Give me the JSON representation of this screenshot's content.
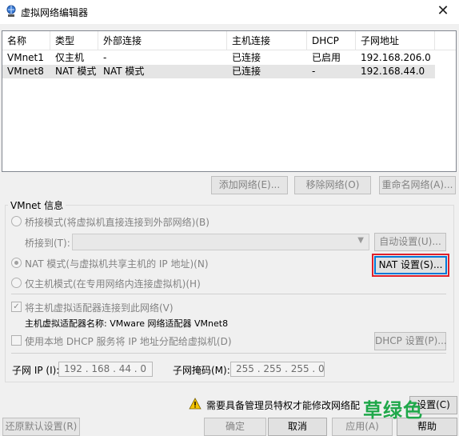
{
  "window": {
    "title": "虚拟网络编辑器",
    "close": "✕"
  },
  "table": {
    "columns": [
      "名称",
      "类型",
      "外部连接",
      "主机连接",
      "DHCP",
      "子网地址"
    ],
    "rows": [
      [
        "VMnet1",
        "仅主机",
        "-",
        "已连接",
        "已启用",
        "192.168.206.0"
      ],
      [
        "VMnet8",
        "NAT 模式",
        "NAT 模式",
        "已连接",
        "-",
        "192.168.44.0"
      ]
    ],
    "selected_row": 1
  },
  "list_buttons": {
    "add": "添加网络(E)...",
    "remove": "移除网络(O)",
    "rename": "重命名网络(A)..."
  },
  "vmnet_info": {
    "label": "VMnet 信息",
    "bridged": "桥接模式(将虚拟机直接连接到外部网络)(B)",
    "bridged_to": "桥接到(T):",
    "auto_settings": "自动设置(U)...",
    "nat": "NAT 模式(与虚拟机共享主机的 IP 地址)(N)",
    "nat_settings": "NAT 设置(S)...",
    "host_only": "仅主机模式(在专用网络内连接虚拟机)(H)",
    "connect_adapter": "将主机虚拟适配器连接到此网络(V)",
    "adapter_name": "主机虚拟适配器名称: VMware 网络适配器 VMnet8",
    "use_dhcp": "使用本地 DHCP 服务将 IP 地址分配给虚拟机(D)",
    "dhcp_settings": "DHCP 设置(P)...",
    "subnet_ip_label": "子网 IP (I):",
    "subnet_ip": "192 . 168 .  44  .  0",
    "subnet_mask_label": "子网掩码(M):",
    "subnet_mask": "255 . 255 . 255 .  0"
  },
  "admin_notice": {
    "text": "需要具备管理员特权才能修改网络配",
    "change_settings": "设置(C)"
  },
  "footer_buttons": {
    "restore": "还原默认设置(R)",
    "ok": "确定",
    "cancel": "取消",
    "apply": "应用(A)",
    "help": "帮助"
  },
  "watermark": "草绿色",
  "icons": {
    "app": "network-globe-icon",
    "warning": "warning-shield-icon",
    "dropdown": "chevron-down-icon"
  },
  "colors": {
    "highlight": "#e0202a",
    "watermark": "#1fa84a",
    "focus": "#0078d7"
  }
}
